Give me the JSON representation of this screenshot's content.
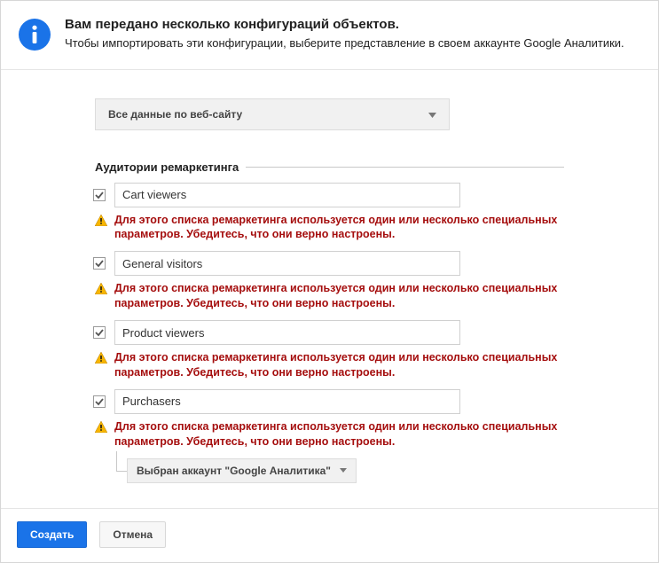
{
  "header": {
    "title": "Вам передано несколько конфигураций объектов.",
    "subtitle": "Чтобы импортировать эти конфигурации, выберите представление в своем аккаунте Google Аналитики."
  },
  "view_select": {
    "selected": "Все данные по веб-сайту"
  },
  "section": {
    "title": "Аудитории ремаркетинга"
  },
  "warning_text": "Для этого списка ремаркетинга используется один или несколько специальных параметров. Убедитесь, что они верно настроены.",
  "audiences": [
    {
      "name": "Cart viewers"
    },
    {
      "name": "General visitors"
    },
    {
      "name": "Product viewers"
    },
    {
      "name": "Purchasers"
    }
  ],
  "account_select": {
    "label": "Выбран аккаунт \"Google Аналитика\""
  },
  "footer": {
    "create": "Создать",
    "cancel": "Отмена"
  }
}
